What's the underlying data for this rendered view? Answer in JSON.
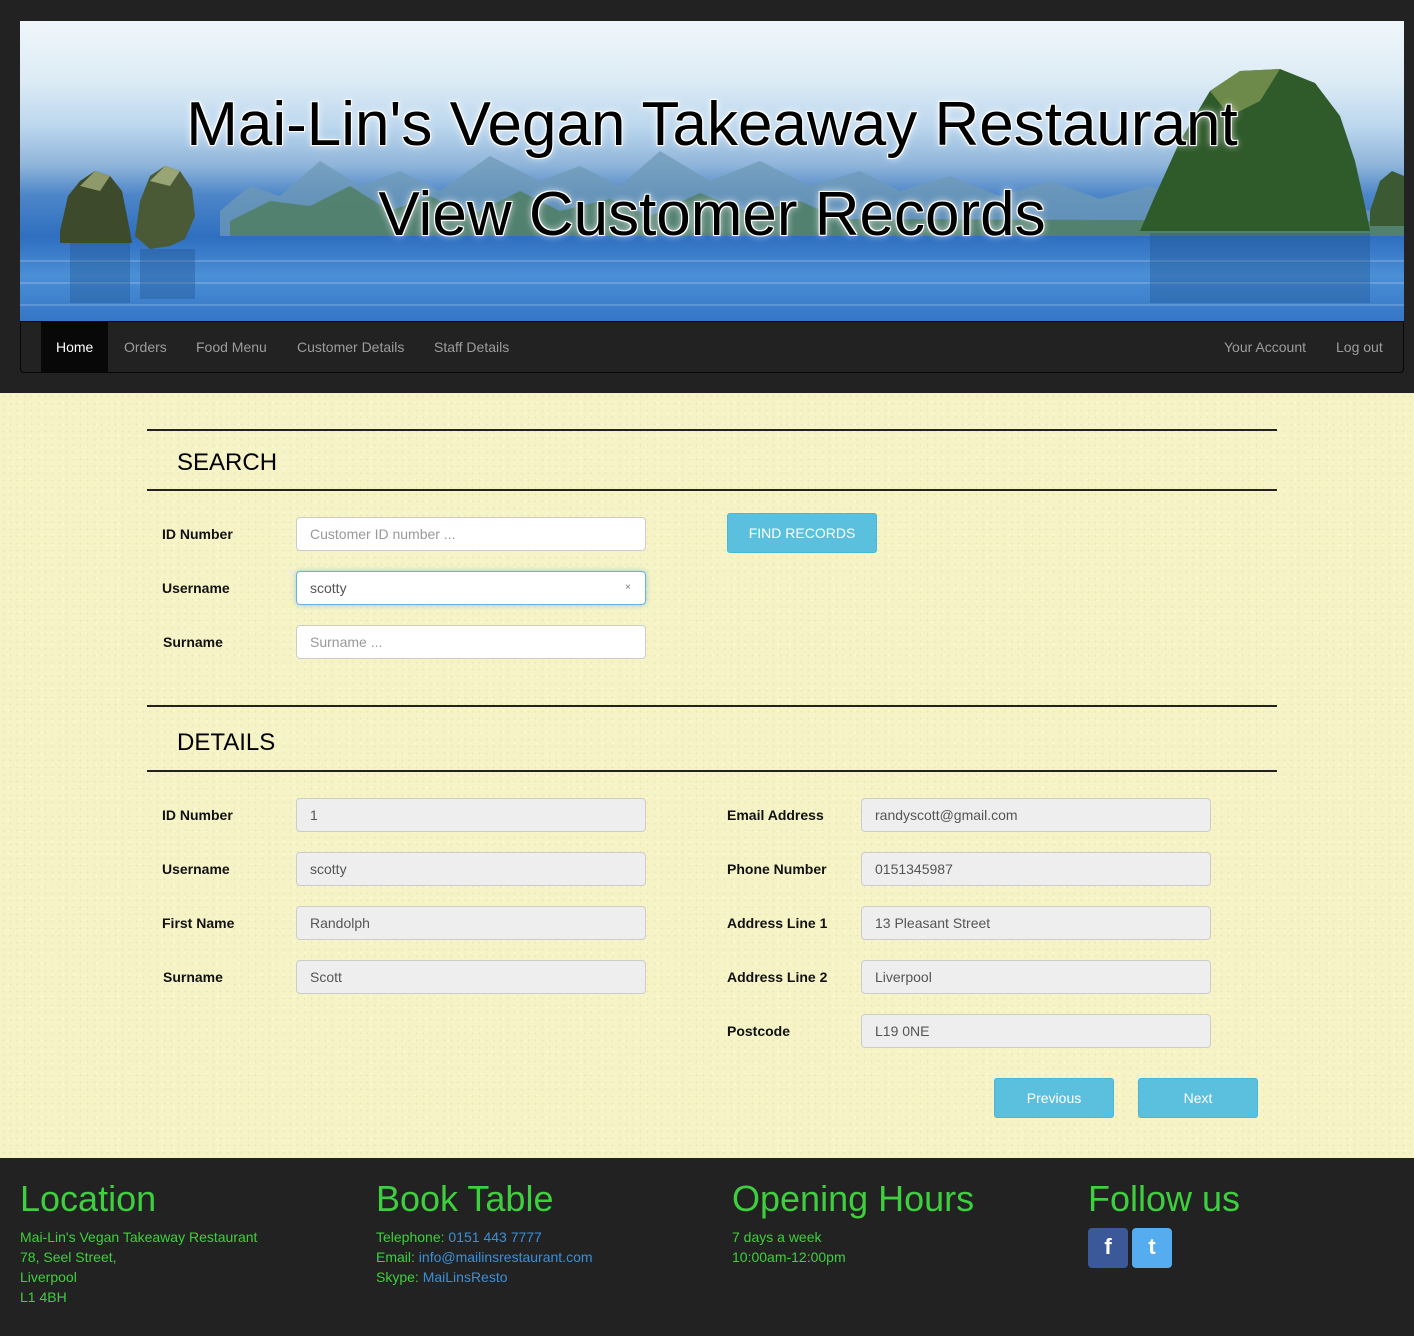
{
  "header": {
    "title": "Mai-Lin's Vegan Takeaway Restaurant",
    "subtitle": "View Customer Records"
  },
  "nav": {
    "left": [
      "Home",
      "Orders",
      "Food Menu",
      "Customer Details",
      "Staff Details"
    ],
    "right": [
      "Your Account",
      "Log out"
    ],
    "active": "Home"
  },
  "search": {
    "heading": "SEARCH",
    "id_label": "ID Number",
    "id_placeholder": "Customer ID number ...",
    "username_label": "Username",
    "username_value": "scotty",
    "surname_label": "Surname",
    "surname_placeholder": "Surname ...",
    "find_button": "FIND RECORDS",
    "clear_glyph": "×"
  },
  "details": {
    "heading": "DETAILS",
    "id_label": "ID Number",
    "id_value": "1",
    "username_label": "Username",
    "username_value": "scotty",
    "first_name_label": "First Name",
    "first_name_value": "Randolph",
    "surname_label": "Surname",
    "surname_value": "Scott",
    "email_label": "Email Address",
    "email_value": "randyscott@gmail.com",
    "phone_label": "Phone Number",
    "phone_value": "0151345987",
    "address1_label": "Address Line 1",
    "address1_value": "13 Pleasant Street",
    "address2_label": "Address Line 2",
    "address2_value": "Liverpool",
    "postcode_label": "Postcode",
    "postcode_value": "L19 0NE",
    "previous_button": "Previous",
    "next_button": "Next"
  },
  "footer": {
    "location": {
      "heading": "Location",
      "lines": [
        "Mai-Lin's Vegan Takeaway Restaurant",
        "78, Seel Street,",
        "Liverpool",
        "L1 4BH"
      ]
    },
    "book": {
      "heading": "Book Table",
      "telephone_label": "Telephone:",
      "telephone": "0151 443 7777",
      "email_label": "Email:",
      "email": "info@mailinsrestaurant.com",
      "skype_label": "Skype:",
      "skype": "MaiLinsResto"
    },
    "hours": {
      "heading": "Opening Hours",
      "lines": [
        "7 days a week",
        "10:00am-12:00pm"
      ]
    },
    "follow": {
      "heading": "Follow us",
      "facebook": "f",
      "twitter": "t"
    }
  },
  "colors": {
    "accent_green": "#3ecf3e",
    "button_blue": "#5bc0de",
    "link_blue": "#3b8fd8",
    "page_bg": "#f6f4c6",
    "facebook": "#3b5998",
    "twitter": "#55acee"
  },
  "icons": [
    "facebook-icon",
    "twitter-icon",
    "clear-icon"
  ]
}
